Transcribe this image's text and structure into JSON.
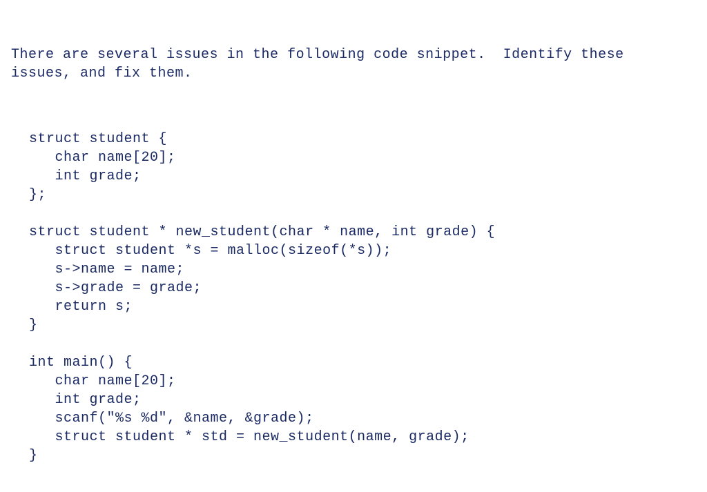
{
  "prompt": {
    "line1": "There are several issues in the following code snippet.  Identify these",
    "line2": "issues, and fix them."
  },
  "code": {
    "l01": "struct student {",
    "l02": "   char name[20];",
    "l03": "   int grade;",
    "l04": "};",
    "l05": "",
    "l06": "struct student * new_student(char * name, int grade) {",
    "l07": "   struct student *s = malloc(sizeof(*s));",
    "l08": "   s->name = name;",
    "l09": "   s->grade = grade;",
    "l10": "   return s;",
    "l11": "}",
    "l12": "",
    "l13": "int main() {",
    "l14": "   char name[20];",
    "l15": "   int grade;",
    "l16": "   scanf(\"%s %d\", &name, &grade);",
    "l17": "   struct student * std = new_student(name, grade);",
    "l18": "}"
  }
}
